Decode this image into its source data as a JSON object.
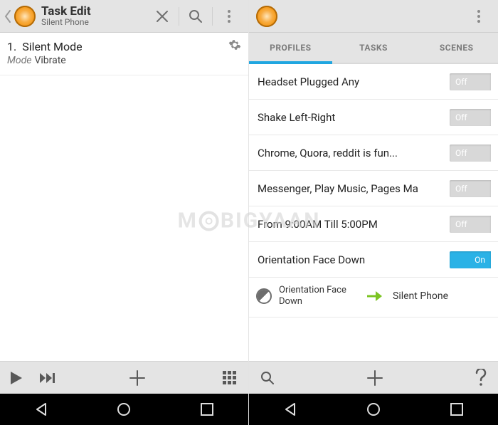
{
  "left": {
    "header": {
      "title": "Task Edit",
      "subtitle": "Silent Phone"
    },
    "task": {
      "index": "1.",
      "name": "Silent Mode",
      "mode_label": "Mode",
      "mode_value": "Vibrate"
    }
  },
  "right": {
    "tabs": [
      {
        "label": "PROFILES",
        "active": true
      },
      {
        "label": "TASKS",
        "active": false
      },
      {
        "label": "SCENES",
        "active": false
      }
    ],
    "profiles": [
      {
        "label": "Headset Plugged Any",
        "state": "Off",
        "on": false
      },
      {
        "label": "Shake Left-Right",
        "state": "Off",
        "on": false
      },
      {
        "label": "Chrome, Quora, reddit is fun...",
        "state": "Off",
        "on": false
      },
      {
        "label": "Messenger, Play Music, Pages Ma",
        "state": "Off",
        "on": false
      },
      {
        "label": "From  9:00AM Till  5:00PM",
        "state": "Off",
        "on": false
      },
      {
        "label": "Orientation Face Down",
        "state": "On",
        "on": true
      }
    ],
    "expanded": {
      "context": "Orientation Face Down",
      "task": "Silent Phone"
    }
  },
  "watermark": "M BIGYAAN"
}
